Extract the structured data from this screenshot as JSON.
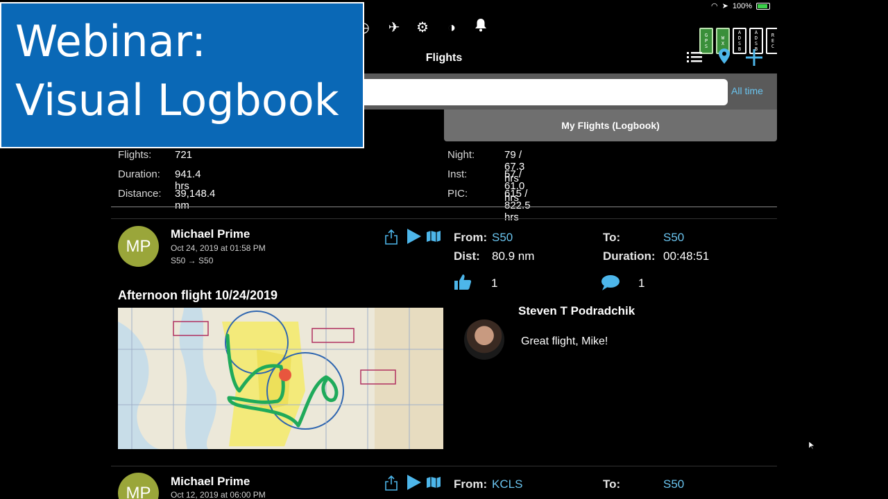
{
  "status": {
    "battery": "100%"
  },
  "toolbar": {
    "device_badges": [
      {
        "letters": [
          "G",
          "P",
          "S"
        ],
        "active": true
      },
      {
        "letters": [
          "W",
          "X"
        ],
        "active": true
      },
      {
        "letters": [
          "A",
          "D",
          "S",
          "B"
        ],
        "active": false
      },
      {
        "letters": [
          "A",
          "D",
          "S",
          "B"
        ],
        "active": false
      },
      {
        "letters": [
          "R",
          "E",
          "C"
        ],
        "active": false
      }
    ]
  },
  "nav": {
    "title": "Flights"
  },
  "search": {
    "placeholder": "",
    "filter_label": "All time"
  },
  "segment": {
    "label": "My Flights (Logbook)"
  },
  "stats": {
    "flights": {
      "label": "Flights:",
      "value": "721"
    },
    "duration": {
      "label": "Duration:",
      "value": "941.4 hrs"
    },
    "distance": {
      "label": "Distance:",
      "value": "39,148.4 nm"
    },
    "night": {
      "label": "Night:",
      "value": "79 / 67.3 hrs"
    },
    "inst": {
      "label": "Inst:",
      "value": "57 / 61.0 hrs"
    },
    "pic": {
      "label": "PIC:",
      "value": "615 / 822.5 hrs"
    }
  },
  "entries": [
    {
      "initials": "MP",
      "pilot": "Michael Prime",
      "date": "Oct 24, 2019 at 01:58 PM",
      "route": "S50 → S50",
      "from_label": "From:",
      "from": "S50",
      "to_label": "To:",
      "to": "S50",
      "dist_label": "Dist:",
      "dist": "80.9 nm",
      "duration_label": "Duration:",
      "duration": "00:48:51",
      "likes": "1",
      "comments": "1",
      "title": "Afternoon flight 10/24/2019",
      "comment": {
        "author": "Steven T Podradchik",
        "text": "Great flight, Mike!"
      }
    },
    {
      "initials": "MP",
      "pilot": "Michael Prime",
      "date": "Oct 12, 2019 at 06:00 PM",
      "from_label": "From:",
      "from": "KCLS",
      "to_label": "To:",
      "to": "S50"
    }
  ],
  "banner": {
    "line1": "Webinar:",
    "line2": "Visual Logbook"
  },
  "colors": {
    "accent": "#4db6ea",
    "banner": "#0a68b6",
    "avatar": "#9aa63a",
    "track": "#1faa5a"
  }
}
